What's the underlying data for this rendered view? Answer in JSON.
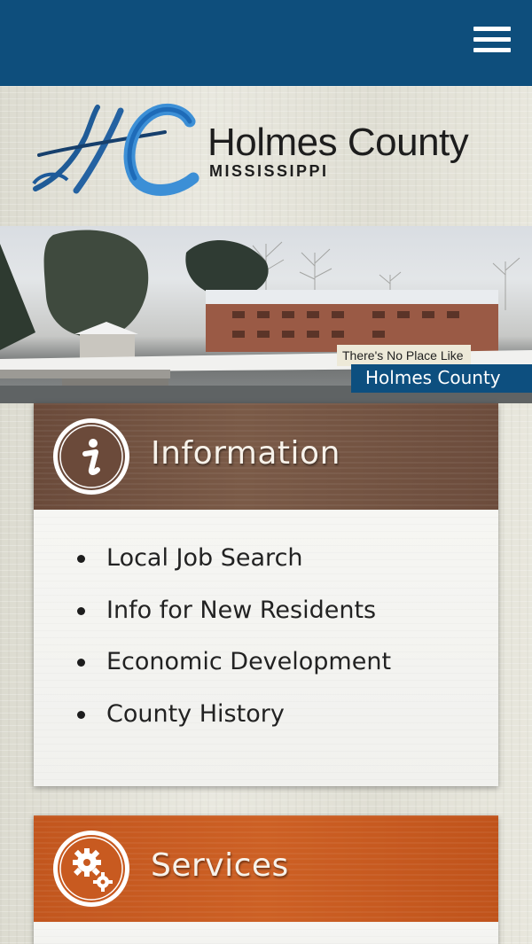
{
  "header": {
    "menu_label": "Menu"
  },
  "logo": {
    "title": "Holmes County",
    "subtitle": "MISSISSIPPI"
  },
  "hero": {
    "caption_small": "There's No Place Like",
    "caption_big": "Holmes County"
  },
  "info_card": {
    "title": "Information",
    "icon": "info-icon",
    "links": [
      "Local Job Search",
      "Info for New Residents",
      "Economic Development",
      "County History"
    ]
  },
  "services_card": {
    "title": "Services",
    "icon": "gears-icon"
  },
  "colors": {
    "topbar": "#0e4e7c",
    "info_header": "#735242",
    "services_header": "#c85a20",
    "caption_banner": "#0d4f7f"
  }
}
